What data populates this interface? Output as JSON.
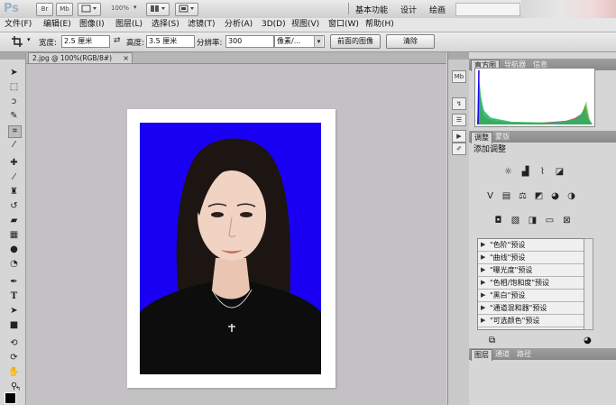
{
  "app": {
    "logo": "Ps",
    "br_label": "Br",
    "mb_label": "Mb",
    "zoom": "100%",
    "workspaces": [
      "基本功能",
      "设计",
      "绘画"
    ]
  },
  "menu": {
    "items": [
      "文件(F)",
      "编辑(E)",
      "图像(I)",
      "图层(L)",
      "选择(S)",
      "滤镜(T)",
      "分析(A)",
      "3D(D)",
      "视图(V)",
      "窗口(W)",
      "帮助(H)"
    ]
  },
  "options": {
    "width_label": "宽度:",
    "width_value": "2.5 厘米",
    "height_label": "高度:",
    "height_value": "3.5 厘米",
    "resolution_label": "分辨率:",
    "resolution_value": "300",
    "unit_value": "像素/...",
    "front_image_button": "前面的图像",
    "clear_button": "清除"
  },
  "document": {
    "tab_title": "2.jpg @ 100%(RGB/8#)",
    "tab_close": "×"
  },
  "panels": {
    "top_tabs": [
      "直方图",
      "导航器",
      "信息"
    ],
    "adjust_tabs": [
      "调整",
      "蒙版"
    ],
    "adjust_title": "添加调整",
    "presets": [
      "\"色阶\"预设",
      "\"曲线\"预设",
      "\"曝光度\"预设",
      "\"色相/饱和度\"预设",
      "\"黑白\"预设",
      "\"通道混和器\"预设",
      "\"可选颜色\"预设"
    ],
    "bottom_tabs": [
      "图层",
      "通道",
      "路径"
    ]
  },
  "colors": {
    "photo_background": "#1a00f2",
    "canvas": "#c3c1c4",
    "chrome": "#d6d6d6"
  }
}
